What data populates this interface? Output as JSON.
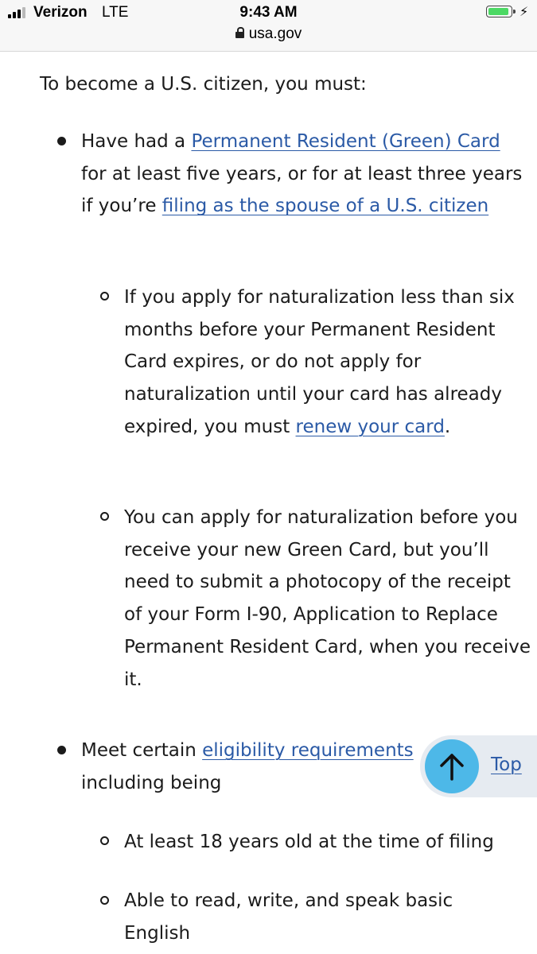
{
  "status_bar": {
    "carrier": "Verizon",
    "network": "LTE",
    "time": "9:43 AM",
    "url": "usa.gov",
    "battery_icon": "battery-charging-icon",
    "signal_icon": "signal-bars-icon",
    "battery_color": "#4cd964"
  },
  "content": {
    "intro": "To become a U.S. citizen, you must:",
    "item1": {
      "prefix": "Have had a ",
      "link1": "Permanent Resident (Green) Card",
      "middle": " for at least five years, or for at least three years if you’re ",
      "link2": "filing as the spouse of a U.S. citizen",
      "sub1": {
        "text": "If you apply for naturalization less than six months before your Permanent Resident Card expires, or do not apply for naturalization until your card has already expired, you must ",
        "link": "renew your card",
        "suffix": "."
      },
      "sub2": {
        "text": "You can apply for naturalization before you receive your new Green Card, but you’ll need to submit a photocopy of the receipt of your Form I-90, Application to Replace Permanent Resident Card, when you receive it."
      }
    },
    "item2": {
      "prefix": "Meet certain ",
      "link": "eligibility requirements",
      "suffix": " including being",
      "sub1": "At least 18 years old at the time of filing",
      "sub2": "Able to read, write, and speak basic English"
    }
  },
  "back_to_top": {
    "label": "Top",
    "icon": "arrow-up-icon",
    "circle_color": "#4db8e8"
  },
  "colors": {
    "link": "#2b5aa6",
    "text": "#1b1b1b"
  }
}
